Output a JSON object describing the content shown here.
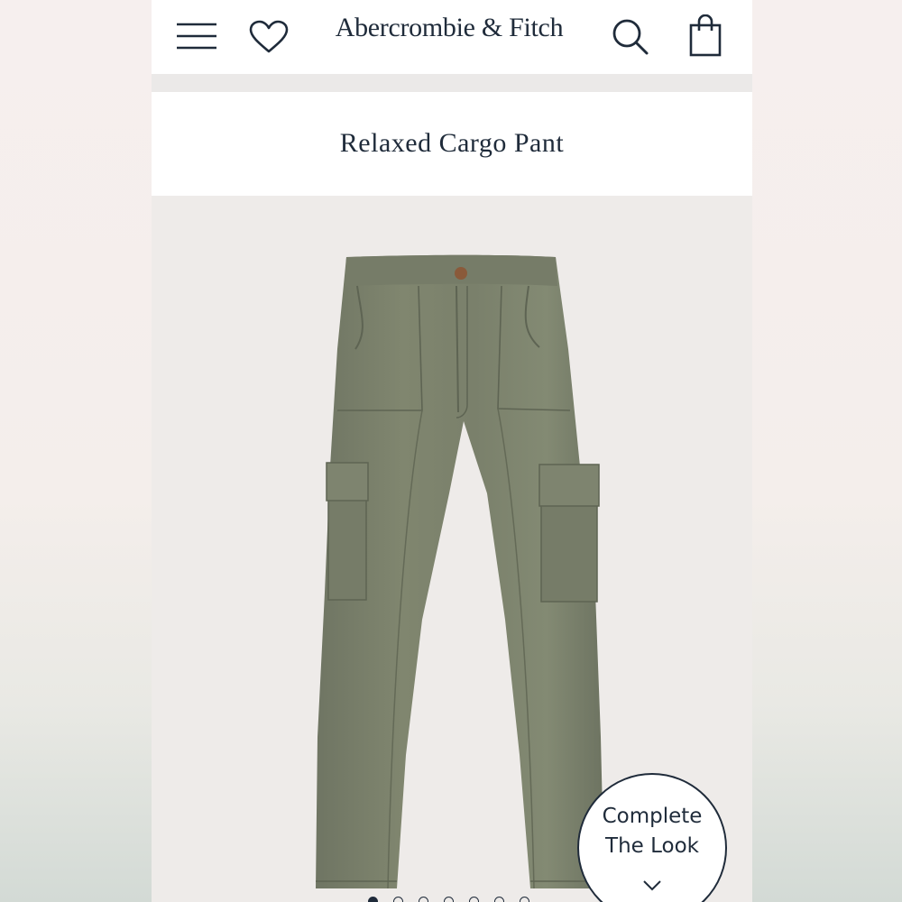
{
  "header": {
    "brand": "Abercrombie & Fitch",
    "menu_icon": "hamburger-menu-icon",
    "wishlist_icon": "heart-icon",
    "search_icon": "search-icon",
    "bag_icon": "shopping-bag-icon"
  },
  "product": {
    "title": "Relaxed Cargo Pant",
    "image_description_icon": "olive-cargo-pants-image",
    "color": "#7b806d"
  },
  "complete_the_look": {
    "line1": "Complete",
    "line2": "The Look",
    "icon": "chevron-down-icon"
  },
  "carousel": {
    "count": 7,
    "active_index": 0
  }
}
